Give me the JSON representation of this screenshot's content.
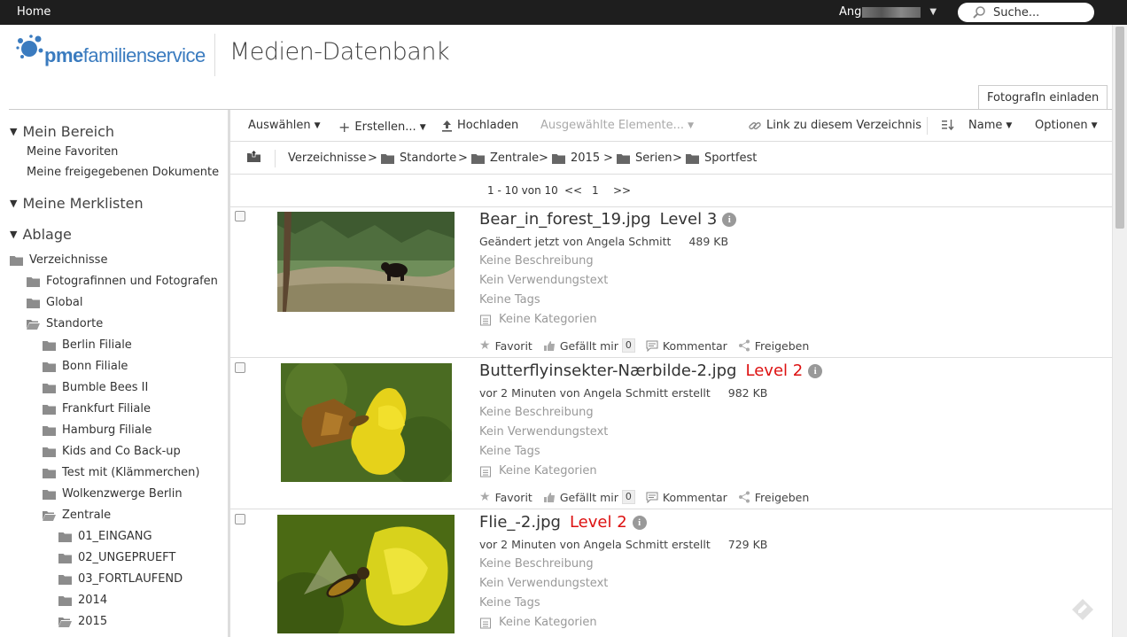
{
  "topbar": {
    "home": "Home",
    "user_name": "Ang",
    "search_placeholder": "Suche..."
  },
  "header": {
    "logo_prefix": "pme",
    "logo_rest": "familienservice",
    "title": "Medien-Datenbank",
    "invite_button": "FotografIn einladen"
  },
  "sidebar": {
    "my_area": {
      "title": "Mein Bereich",
      "links": [
        "Meine Favoriten",
        "Meine freigegebenen Dokumente"
      ]
    },
    "watchlists": {
      "title": "Meine Merklisten"
    },
    "storage": {
      "title": "Ablage",
      "folders": [
        {
          "label": "Verzeichnisse",
          "level": 0
        },
        {
          "label": "Fotografinnen und Fotografen",
          "level": 1
        },
        {
          "label": "Global",
          "level": 1
        },
        {
          "label": "Standorte",
          "level": 1,
          "open": true
        },
        {
          "label": "Berlin Filiale",
          "level": 2
        },
        {
          "label": "Bonn Filiale",
          "level": 2
        },
        {
          "label": "Bumble Bees II",
          "level": 2
        },
        {
          "label": "Frankfurt Filiale",
          "level": 2
        },
        {
          "label": "Hamburg Filiale",
          "level": 2
        },
        {
          "label": "Kids and Co Back-up",
          "level": 2
        },
        {
          "label": "Test mit (Klämmerchen)",
          "level": 2
        },
        {
          "label": "Wolkenzwerge Berlin",
          "level": 2
        },
        {
          "label": "Zentrale",
          "level": 2,
          "open": true
        },
        {
          "label": "01_EINGANG",
          "level": 3
        },
        {
          "label": "02_UNGEPRUEFT",
          "level": 3
        },
        {
          "label": "03_FORTLAUFEND",
          "level": 3
        },
        {
          "label": "2014",
          "level": 3
        },
        {
          "label": "2015",
          "level": 3,
          "open": true
        }
      ]
    }
  },
  "toolbar": {
    "select": "Auswählen",
    "create": "Erstellen...",
    "upload": "Hochladen",
    "selected_items": "Ausgewählte Elemente...",
    "link_dir": "Link zu diesem Verzeichnis",
    "sort_name": "Name",
    "options": "Optionen"
  },
  "breadcrumbs": {
    "root": "Verzeichnisse",
    "items": [
      "Standorte",
      "Zentrale",
      "2015",
      "Serien",
      "Sportfest"
    ],
    "separator": ">"
  },
  "pager": {
    "range": "1 - 10 von 10",
    "prev": "<<",
    "page": "1",
    "next": ">>"
  },
  "labels": {
    "no_description": "Keine Beschreibung",
    "no_usage": "Kein Verwendungstext",
    "no_tags": "Keine Tags",
    "no_categories": "Keine Kategorien",
    "favorite": "Favorit",
    "like": "Gefällt mir",
    "comment": "Kommentar",
    "share": "Freigeben"
  },
  "items": [
    {
      "filename": "Bear_in_forest_19.jpg",
      "level": "Level 3",
      "level_red": false,
      "meta": "Geändert jetzt von Angela Schmitt",
      "size": "489 KB",
      "likes": "0"
    },
    {
      "filename": "Butterflyinsekter-Nærbilde-2.jpg",
      "level": "Level 2",
      "level_red": true,
      "meta": "vor 2 Minuten von Angela Schmitt erstellt",
      "size": "982 KB",
      "likes": "0"
    },
    {
      "filename": "Flie_-2.jpg",
      "level": "Level 2",
      "level_red": true,
      "meta": "vor 2 Minuten von Angela Schmitt erstellt",
      "size": "729 KB",
      "likes": "0"
    }
  ],
  "colors": {
    "topbar": "#1e1e1e",
    "brand_blue": "#3a7bbf",
    "level_red": "#dd1111"
  }
}
